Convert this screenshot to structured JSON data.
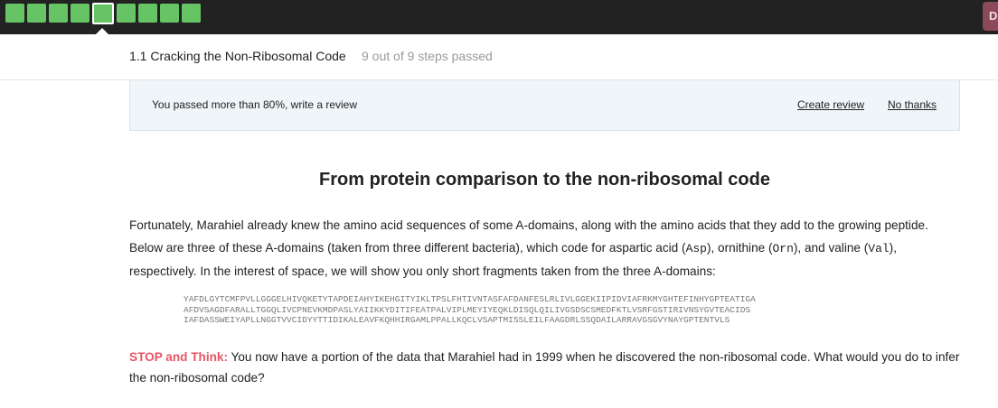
{
  "topbar": {
    "steps_total": 9,
    "steps_passed": 9,
    "current_step": 5,
    "step_color": "#66c464",
    "avatar_initial": "D"
  },
  "lesson": {
    "title": "1.1 Cracking the Non-Ribosomal Code",
    "progress": "9 out of 9 steps passed"
  },
  "review": {
    "message": "You passed more than 80%, write a review",
    "create_label": "Create review",
    "dismiss_label": "No thanks"
  },
  "content": {
    "heading": "From protein comparison to the non-ribosomal code",
    "para_1": "Fortunately, Marahiel already knew the amino acid sequences of some A-domains, along with the amino acids that they add to the growing peptide. Below are three of these A-domains (taken from three different bacteria), which code for aspartic acid (",
    "code_asp": "Asp",
    "para_2": "), ornithine (",
    "code_orn": "Orn",
    "para_3": "), and valine (",
    "code_val": "Val",
    "para_4": "), respectively. In the interest of space, we will show you only short fragments taken from the three A-domains:",
    "sequences": [
      "YAFDLGYTCMFPVLLGGGELHIVQKETYTAPDEIAHYIKEHGITYIKLTPSLFHTIVNTASFAFDANFESLRLIVLGGEKIIPIDVIAFRKMYGHTEFINHYGPTEATIGA",
      "AFDVSAGDFARALLTGGQLIVCPNEVKMDPASLYAIIKKYDITIFEATPALVIPLMEYIYEQKLDISQLQILIVGSDSCSMEDFKTLVSRFGSTIRIVNSYGVTEACIDS",
      "IAFDASSWEIYAPLLNGGTVVCIDYYTTIDIKALEAVFKQHHIRGAMLPPALLKQCLVSAPTMISSLEILFAAGDRLSSQDAILARRAVGSGVYNAYGPTENTVLS"
    ],
    "stop_label": "STOP and Think:",
    "stop_text": " You now have a portion of the data that Marahiel had in 1999 when he discovered the non-ribosomal code. What would you do to infer the non-ribosomal code?"
  }
}
